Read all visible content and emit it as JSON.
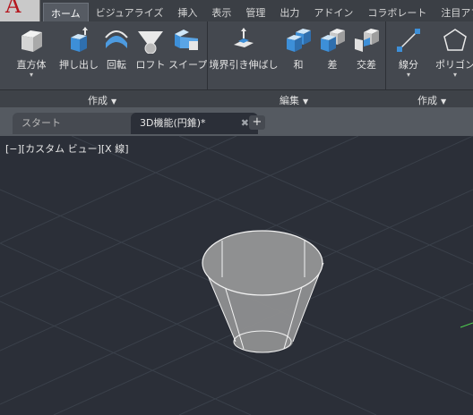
{
  "menu_tabs": [
    "ホーム",
    "ビジュアライズ",
    "挿入",
    "表示",
    "管理",
    "出力",
    "アドイン",
    "コラボレート",
    "注目アプ"
  ],
  "active_tab": "ホーム",
  "tools": {
    "box": "直方体",
    "extrude": "押し出し",
    "revolve": "回転",
    "loft": "ロフト",
    "sweep": "スイープ",
    "presspull": "境界引き伸ばし",
    "union": "和",
    "subtract": "差",
    "intersect": "交差",
    "line": "線分",
    "polygon": "ポリゴン"
  },
  "panels": {
    "create": "作成",
    "edit": "編集",
    "draw": "作成"
  },
  "document_tabs": {
    "start": "スタート",
    "current": "3D機能(円錐)*"
  },
  "viewport": {
    "label": "[−][カスタム ビュー][X 線]"
  },
  "colors": {
    "background": "#2b2f38",
    "grid": "#3c424d",
    "solid": "#9a9a9a",
    "edge": "#f2f2f2"
  },
  "icons": [
    "app-logo-icon",
    "box-icon",
    "extrude-icon",
    "revolve-icon",
    "loft-icon",
    "sweep-icon",
    "presspull-icon",
    "union-icon",
    "subtract-icon",
    "intersect-icon",
    "line-icon",
    "polygon-icon",
    "close-icon",
    "plus-icon"
  ]
}
